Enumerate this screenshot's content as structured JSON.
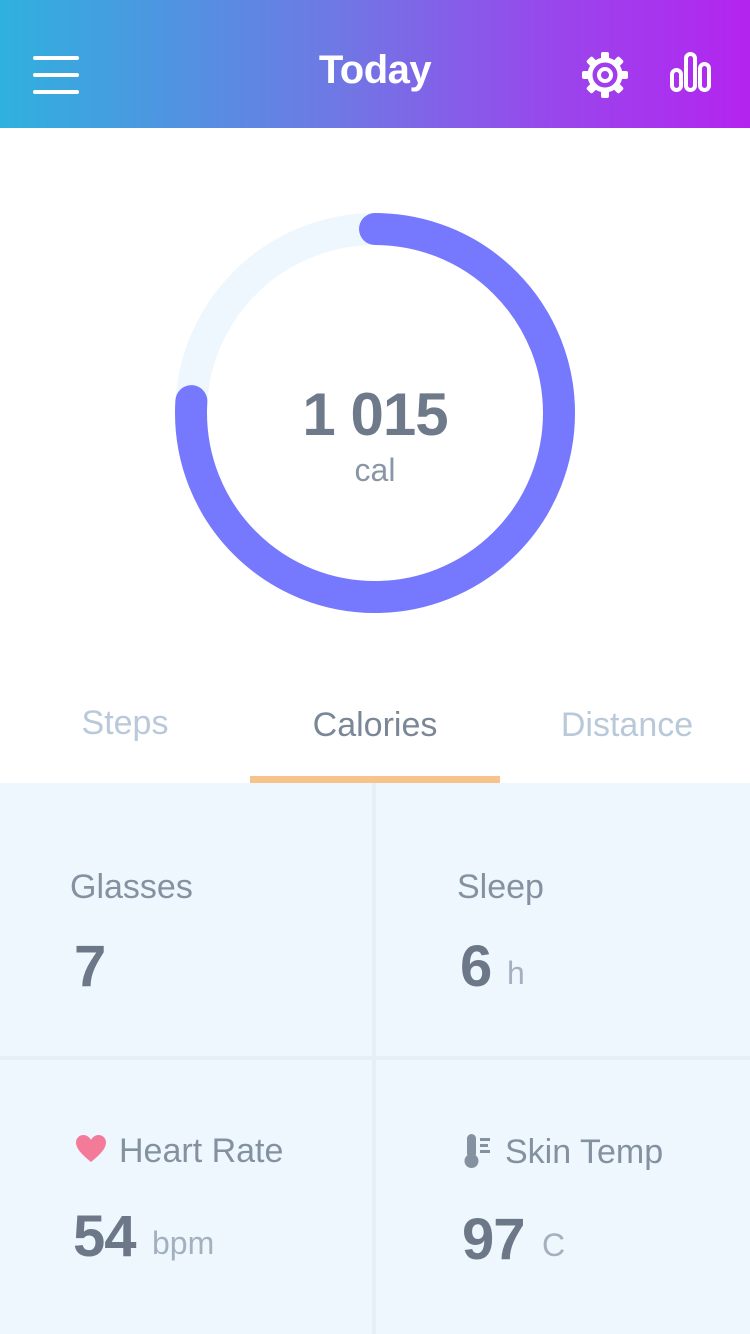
{
  "header": {
    "title": "Today",
    "menu_icon": "hamburger-menu-icon",
    "settings_icon": "gear-icon",
    "stats_icon": "bar-chart-icon",
    "gradient": [
      "#2fb1de",
      "#b424ef"
    ]
  },
  "ring": {
    "value": "1 015",
    "unit": "cal",
    "progress": 0.76,
    "track_color": "#eef7fd",
    "fill_color": "#7678fe"
  },
  "tabs": [
    {
      "label": "Steps",
      "active": false
    },
    {
      "label": "Calories",
      "active": true
    },
    {
      "label": "Distance",
      "active": false
    }
  ],
  "accent_color": "#f8c28d",
  "tiles": {
    "glasses": {
      "label": "Glasses",
      "value": "7",
      "unit": ""
    },
    "sleep": {
      "label": "Sleep",
      "value": "6",
      "unit": "h"
    },
    "heart_rate": {
      "label": "Heart Rate",
      "value": "54",
      "unit": "bpm",
      "icon": "heart-icon",
      "icon_color": "#f47a9a"
    },
    "skin_temp": {
      "label": "Skin Temp",
      "value": "97",
      "unit": "C",
      "icon": "thermometer-icon"
    }
  }
}
